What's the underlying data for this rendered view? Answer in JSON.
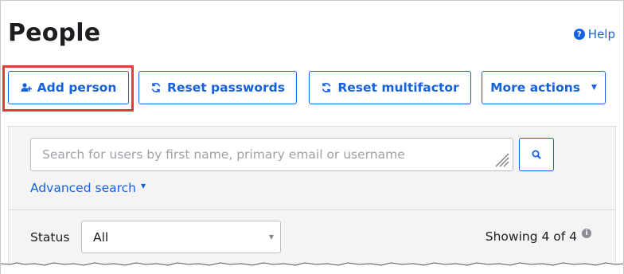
{
  "header": {
    "title": "People",
    "help_label": "Help",
    "help_icon": "question-circle-icon"
  },
  "toolbar": {
    "add_person_label": "Add person",
    "add_person_icon": "add-user-icon",
    "reset_passwords_label": "Reset passwords",
    "reset_passwords_icon": "refresh-icon",
    "reset_multifactor_label": "Reset multifactor",
    "reset_multifactor_icon": "refresh-icon",
    "more_actions_label": "More actions",
    "more_actions_icon": "caret-down-icon"
  },
  "search": {
    "placeholder": "Search for users by first name, primary email or username",
    "value": "",
    "search_icon": "search-icon",
    "advanced_label": "Advanced search"
  },
  "filter": {
    "status_label": "Status",
    "status_value": "All",
    "showing_text": "Showing 4 of 4",
    "info_icon": "info-icon"
  },
  "colors": {
    "accent": "#1662dd",
    "highlight": "#d9423b",
    "panel_bg": "#f4f4f4",
    "text": "#1d1d21"
  }
}
